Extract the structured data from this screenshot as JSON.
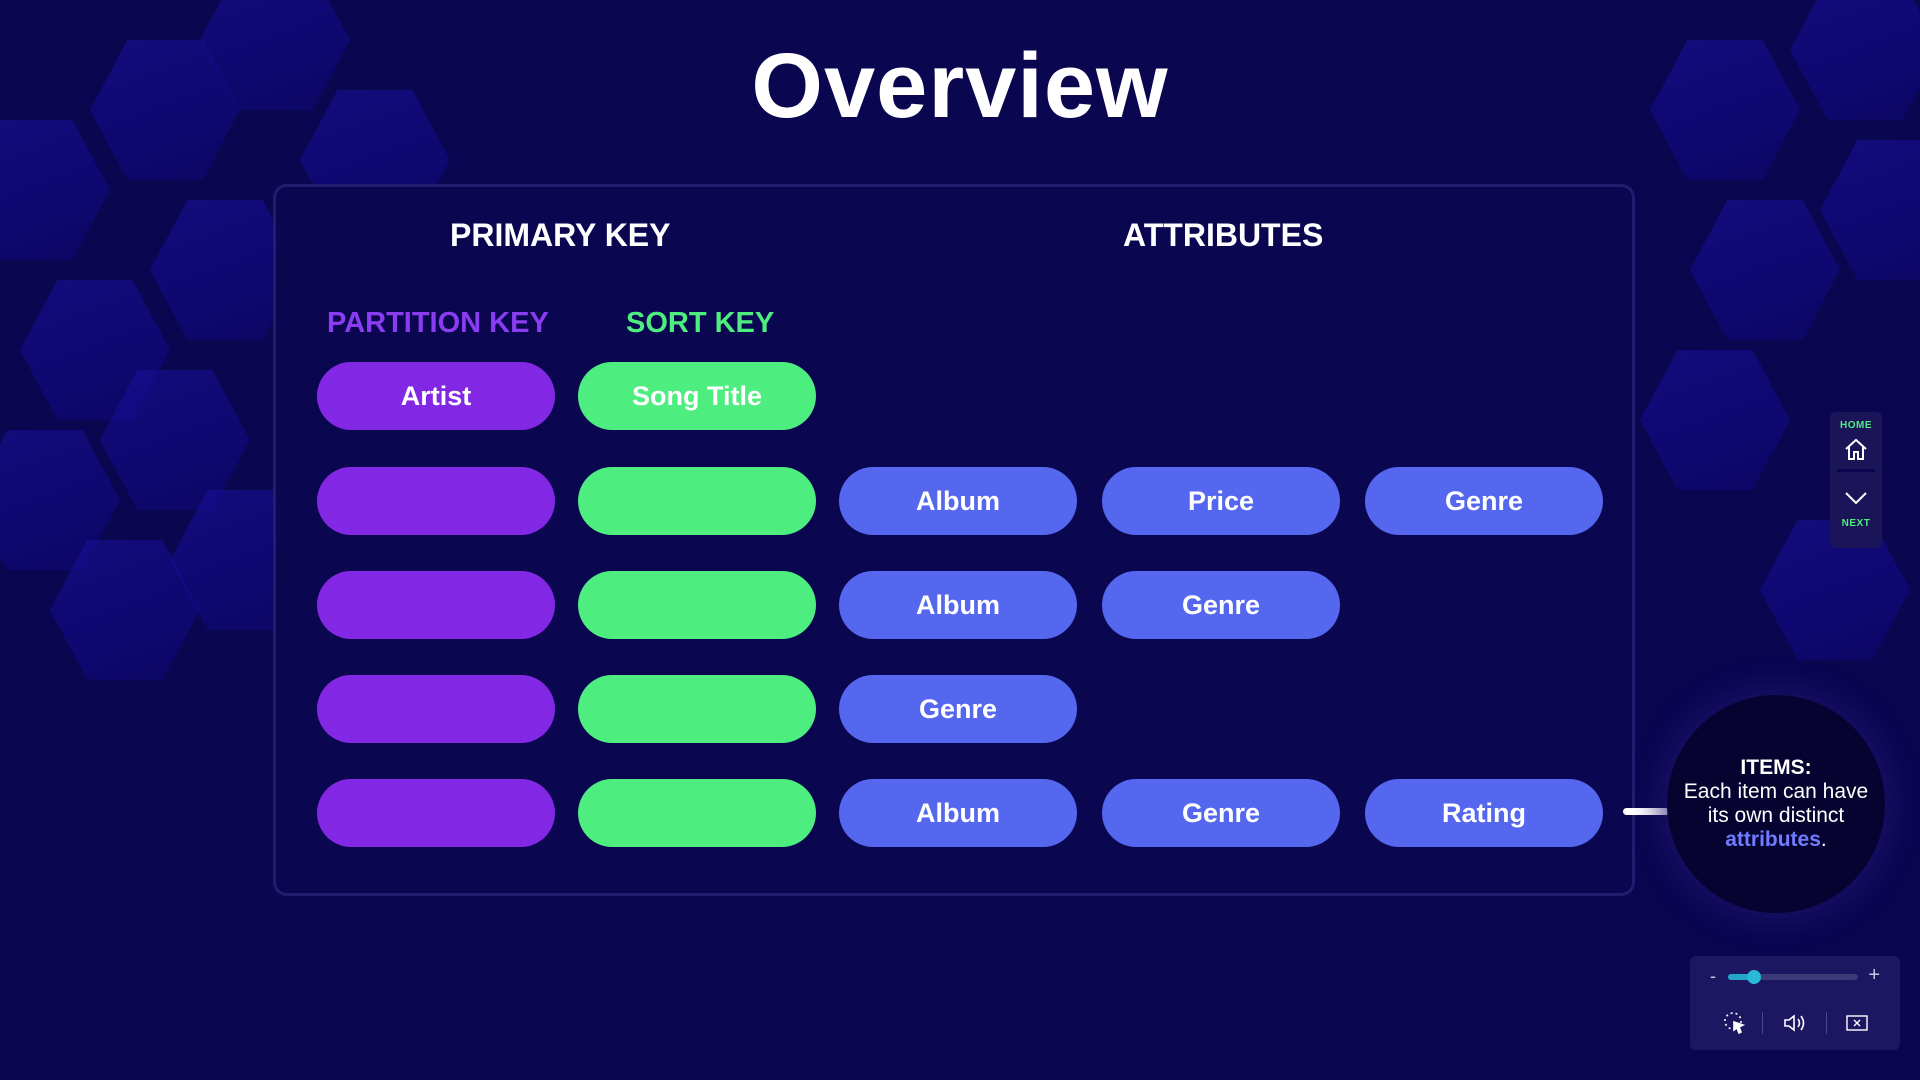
{
  "slide": {
    "title": "Overview"
  },
  "table": {
    "primary_key_heading": "PRIMARY KEY",
    "attributes_heading": "ATTRIBUTES",
    "partition_key_heading": "PARTITION KEY",
    "sort_key_heading": "SORT KEY",
    "partition_key_color": "#8228e4",
    "sort_key_color": "#4ded80",
    "attribute_color": "#5467ee",
    "header_row": {
      "partition_key": "Artist",
      "sort_key": "Song Title"
    },
    "items": [
      {
        "attributes": [
          "Album",
          "Price",
          "Genre"
        ]
      },
      {
        "attributes": [
          "Album",
          "Genre"
        ]
      },
      {
        "attributes": [
          "Genre"
        ]
      },
      {
        "attributes": [
          "Album",
          "Genre",
          "Rating"
        ]
      }
    ]
  },
  "callout": {
    "title": "ITEMS:",
    "text_before": "Each item can have its own distinct ",
    "highlight": "attributes",
    "text_after": "."
  },
  "nav": {
    "home_label": "HOME",
    "next_label": "NEXT",
    "home_icon": "home-icon",
    "next_icon": "chevron-down-icon"
  },
  "controls": {
    "minus_label": "-",
    "plus_label": "+",
    "volume_level_fraction": 0.2,
    "pointer_icon": "pointer-icon",
    "speaker_icon": "speaker-icon",
    "close_icon": "close-icon"
  }
}
